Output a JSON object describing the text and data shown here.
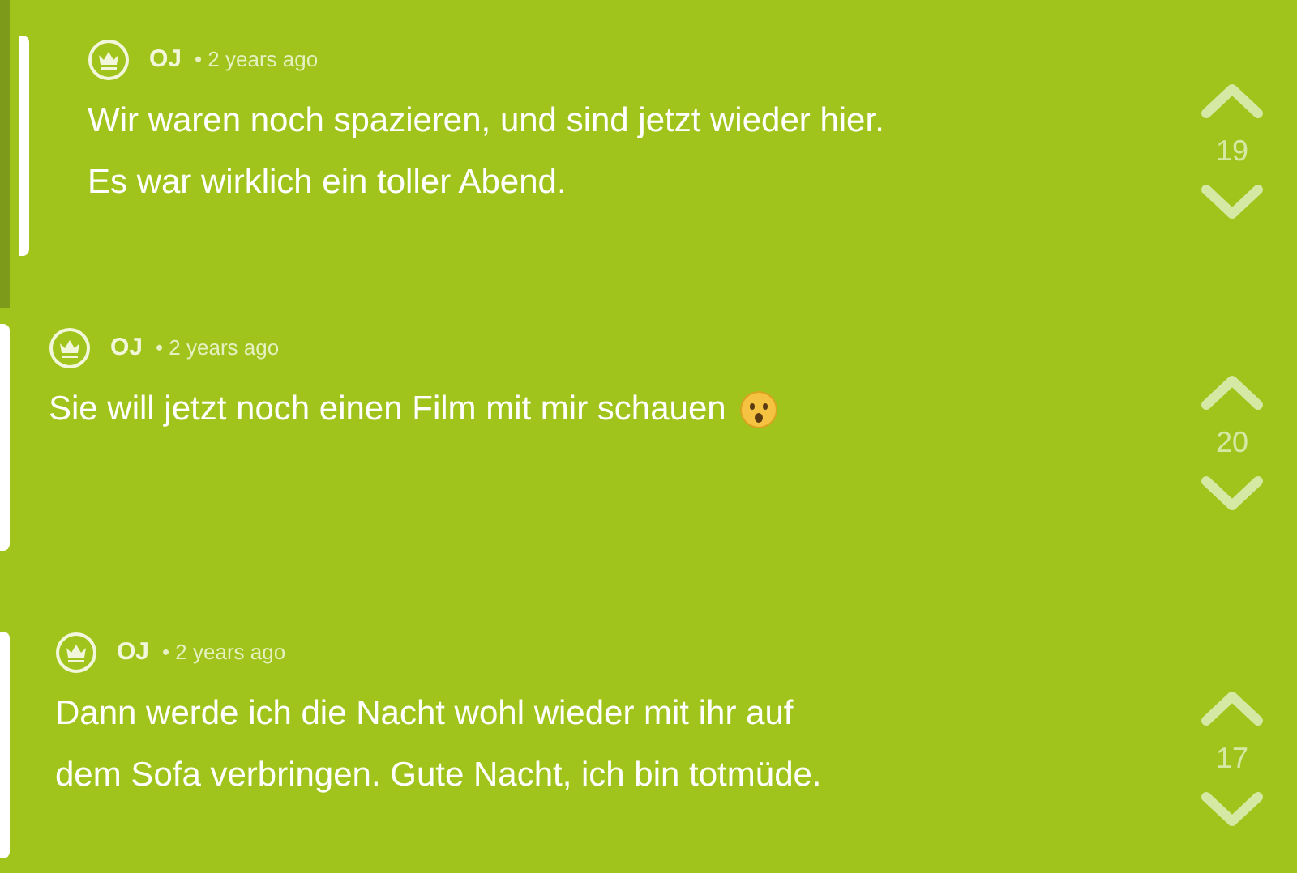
{
  "posts": [
    {
      "author": "OJ",
      "time": "• 2 years ago",
      "lines": [
        "Wir waren noch spazieren, und sind jetzt wieder hier.",
        "Es war wirklich ein toller Abend."
      ],
      "emoji": false,
      "votes": "19"
    },
    {
      "author": "OJ",
      "time": "• 2 years ago",
      "lines": [
        "Sie will jetzt noch einen Film mit mir schauen"
      ],
      "emoji": true,
      "votes": "20"
    },
    {
      "author": "OJ",
      "time": "• 2 years ago",
      "lines": [
        "Dann werde ich die Nacht wohl wieder mit ihr auf",
        "dem Sofa verbringen. Gute Nacht, ich bin totmüde."
      ],
      "emoji": false,
      "votes": "17"
    }
  ]
}
